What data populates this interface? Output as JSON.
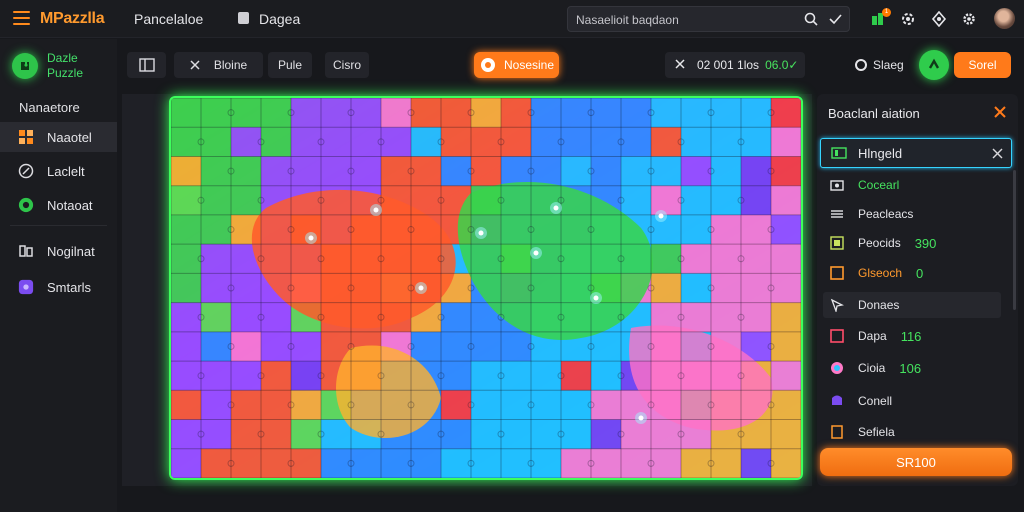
{
  "app": {
    "title": "MPazzlla",
    "menu": [
      "Pancelaloe",
      "Dagea"
    ]
  },
  "search": {
    "placeholder": "Nasaelioit baqdaon"
  },
  "topbar": {
    "notification_count": "1",
    "icons": [
      "search-icon",
      "check-icon",
      "notification-icon",
      "settings-icon",
      "theme-icon",
      "gear-icon",
      "avatar"
    ]
  },
  "sidebar": {
    "logo_text_line1": "Dazle",
    "logo_text_line2": "Puzzle",
    "heading": "Nanaetore",
    "items": [
      {
        "label": "Naaotel",
        "icon": "puzzle-piece-icon",
        "active": true
      },
      {
        "label": "Laclelt",
        "icon": "compass-icon",
        "active": false
      },
      {
        "label": "Notaoat",
        "icon": "leaf-icon",
        "active": false
      },
      {
        "label": "Nogilnat",
        "icon": "user-group-icon",
        "active": false
      },
      {
        "label": "Smtarls",
        "icon": "star-icon",
        "active": false
      }
    ]
  },
  "toolbar": {
    "buttons": [
      "Bloine",
      "Pule",
      "Cisro"
    ],
    "mode_label": "Nosesine",
    "timer_text": "02 001 1los",
    "progress_text": "06.0✓",
    "share_label": "Slaeg",
    "action_label": "Sorel"
  },
  "panel": {
    "title": "Boaclanl aiation",
    "selected_label": "Hlngeld",
    "rows": [
      {
        "label": "Cocearl",
        "value": "",
        "icon": "camera-icon",
        "label_color": "#45e35f"
      },
      {
        "label": "Peacleacs",
        "value": "",
        "icon": "list-icon",
        "label_color": "#e4e4e8"
      },
      {
        "label": "Peocids",
        "value": "390",
        "icon": "grid-icon",
        "label_color": "#e4e4e8"
      },
      {
        "label": "Glseoch",
        "value": "0",
        "icon": "square-icon",
        "label_color": "#ff9a2e"
      },
      {
        "label": "Donaes",
        "value": "",
        "icon": "cursor-icon",
        "label_color": "#e4e4e8"
      },
      {
        "label": "Dapa",
        "value": "116",
        "icon": "box-icon",
        "label_color": "#e4e4e8"
      },
      {
        "label": "Cioia",
        "value": "106",
        "icon": "palette-icon",
        "label_color": "#e4e4e8"
      },
      {
        "label": "Conell",
        "value": "",
        "icon": "cube-icon",
        "label_color": "#e4e4e8"
      },
      {
        "label": "Sefiela",
        "value": "",
        "icon": "note-icon",
        "label_color": "#e4e4e8"
      }
    ],
    "action_label": "SR100"
  },
  "colors": {
    "accent_orange": "#ff7a1a",
    "accent_green": "#3dff5c",
    "panel_highlight": "#36d4ff"
  }
}
